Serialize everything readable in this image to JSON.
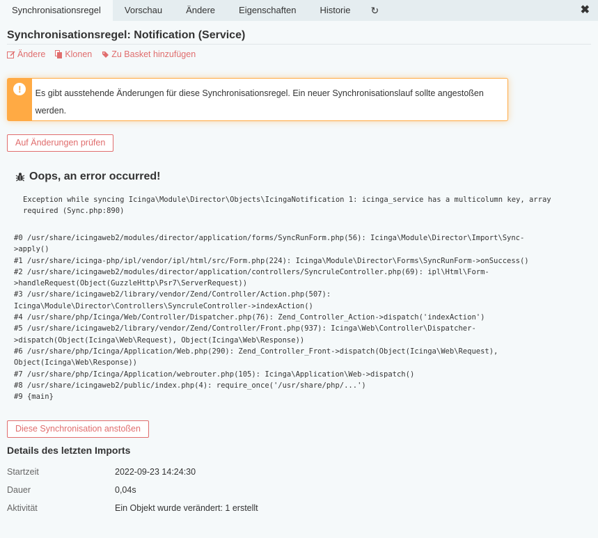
{
  "tabs": {
    "items": [
      "Synchronisationsregel",
      "Vorschau",
      "Ändere",
      "Eigenschaften",
      "Historie"
    ],
    "refresh_icon": "↻",
    "close_icon": "✖"
  },
  "page": {
    "title": "Synchronisationsregel: Notification (Service)"
  },
  "actions": {
    "edit": {
      "icon": "edit-icon",
      "label": "Ändere"
    },
    "clone": {
      "icon": "copy-icon",
      "label": "Klonen"
    },
    "basket": {
      "icon": "tag-icon",
      "label": "Zu Basket hinzufügen"
    }
  },
  "warning": {
    "icon": "!",
    "text": "Es gibt ausstehende Änderungen für diese Synchronisationsregel. Ein neuer Synchronisationslauf sollte angestoßen werden."
  },
  "buttons": {
    "check": "Auf Änderungen prüfen",
    "run": "Diese Synchronisation anstoßen"
  },
  "error": {
    "title": "Oops, an error occurred!",
    "message": "Exception while syncing Icinga\\Module\\Director\\Objects\\IcingaNotification 1: icinga_service has a multicolumn key, array\nrequired (Sync.php:890)",
    "trace": [
      "#0 /usr/share/icingaweb2/modules/director/application/forms/SyncRunForm.php(56): Icinga\\Module\\Director\\Import\\Sync-\n>apply()",
      "#1 /usr/share/icinga-php/ipl/vendor/ipl/html/src/Form.php(224): Icinga\\Module\\Director\\Forms\\SyncRunForm->onSuccess()",
      "#2 /usr/share/icingaweb2/modules/director/application/controllers/SyncruleController.php(69): ipl\\Html\\Form-\n>handleRequest(Object(GuzzleHttp\\Psr7\\ServerRequest))",
      "#3 /usr/share/icingaweb2/library/vendor/Zend/Controller/Action.php(507):\nIcinga\\Module\\Director\\Controllers\\SyncruleController->indexAction()",
      "#4 /usr/share/php/Icinga/Web/Controller/Dispatcher.php(76): Zend_Controller_Action->dispatch('indexAction')",
      "#5 /usr/share/icingaweb2/library/vendor/Zend/Controller/Front.php(937): Icinga\\Web\\Controller\\Dispatcher-\n>dispatch(Object(Icinga\\Web\\Request), Object(Icinga\\Web\\Response))",
      "#6 /usr/share/php/Icinga/Application/Web.php(290): Zend_Controller_Front->dispatch(Object(Icinga\\Web\\Request),\nObject(Icinga\\Web\\Response))",
      "#7 /usr/share/php/Icinga/Application/webrouter.php(105): Icinga\\Application\\Web->dispatch()",
      "#8 /usr/share/icingaweb2/public/index.php(4): require_once('/usr/share/php/...')",
      "#9 {main}"
    ]
  },
  "details": {
    "title": "Details des letzten Imports",
    "rows": [
      {
        "label": "Startzeit",
        "value": "2022-09-23 14:24:30"
      },
      {
        "label": "Dauer",
        "value": "0,04s"
      },
      {
        "label": "Aktivität",
        "value": "Ein Objekt wurde verändert: 1 erstellt"
      }
    ]
  },
  "colors": {
    "accent": "#e06d6d",
    "warning": "#ffaa44",
    "tabbar": "#e5edf0",
    "background": "#f5f9fa"
  }
}
